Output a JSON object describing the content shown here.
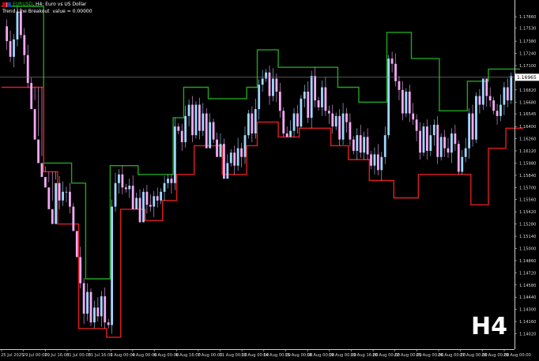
{
  "header": {
    "symbol": "EURUSD",
    "period_line": "H4:  Euro vs US Dollar",
    "indicator_name": "Trend Line Breakout",
    "indicator_value": "value = 0.00000"
  },
  "timeframe_badge": "H4",
  "current_price_label": "1.16965",
  "colors": {
    "background": "#000000",
    "upper_band": "#1fa51f",
    "lower_band": "#e01e1e",
    "bull_candle": "#9fd8ff",
    "bear_candle": "#f5a8f5",
    "axis_text": "#d8d8d8"
  },
  "chart_data": {
    "type": "candlestick",
    "title": "",
    "xlabel": "",
    "ylabel": "",
    "ylim": [
      1.1397,
      1.1778
    ],
    "grid": false,
    "y_ticks": [
      "1.17660",
      "1.17530",
      "1.17380",
      "1.17240",
      "1.17100",
      "1.16960",
      "1.16820",
      "1.16680",
      "1.16545",
      "1.16400",
      "1.16260",
      "1.16120",
      "1.15980",
      "1.15840",
      "1.15700",
      "1.15560",
      "1.15420",
      "1.15280",
      "1.15140",
      "1.15000",
      "1.14860",
      "1.14720",
      "1.14580",
      "1.14440",
      "1.14300",
      "1.14160",
      "1.14020"
    ],
    "x_ticks": [
      "25 Jul 2025",
      "29 Jul 00:00",
      "29 Jul 16:00",
      "31 Jul 00:00",
      "31 Jul 16:00",
      "1 Aug 00:00",
      "4 Aug 00:00",
      "6 Aug 00:00",
      "6 Aug 16:00",
      "7 Aug 00:00",
      "11 Aug 00:00",
      "13 Aug 00:00",
      "14 Aug 00:00",
      "15 Aug 00:00",
      "18 Aug 00:00",
      "19 Aug 00:00",
      "19 Aug 16:00",
      "20 Aug 00:00",
      "22 Aug 00:00",
      "25 Aug 00:00",
      "26 Aug 00:00",
      "27 Aug 00:00",
      "28 Aug 00:00",
      "29 Aug 00:00"
    ],
    "current_price": 1.16965,
    "closes": [
      1.1755,
      1.1738,
      1.172,
      1.174,
      1.1772,
      1.1745,
      1.1722,
      1.169,
      1.166,
      1.1625,
      1.1598,
      1.1582,
      1.157,
      1.1545,
      1.1528,
      1.1575,
      1.1555,
      1.1565,
      1.1565,
      1.1548,
      1.152,
      1.149,
      1.146,
      1.1425,
      1.145,
      1.1415,
      1.1432,
      1.1422,
      1.1445,
      1.1415,
      1.1412,
      1.1548,
      1.1575,
      1.1585,
      1.157,
      1.1568,
      1.1572,
      1.1545,
      1.1558,
      1.153,
      1.1565,
      1.155,
      1.1548,
      1.156,
      1.1555,
      1.1565,
      1.1575,
      1.158,
      1.1575,
      1.164,
      1.1635,
      1.1622,
      1.1652,
      1.1665,
      1.163,
      1.1665,
      1.1635,
      1.1655,
      1.1615,
      1.1645,
      1.1625,
      1.1605,
      1.162,
      1.158,
      1.1598,
      1.161,
      1.1595,
      1.1615,
      1.1605,
      1.163,
      1.1655,
      1.1632,
      1.166,
      1.1688,
      1.1695,
      1.1702,
      1.1675,
      1.1695,
      1.168,
      1.1658,
      1.1632,
      1.1628,
      1.1635,
      1.1655,
      1.164,
      1.1672,
      1.168,
      1.165,
      1.1698,
      1.167,
      1.1662,
      1.1685,
      1.1658,
      1.1655,
      1.164,
      1.1652,
      1.1625,
      1.1655,
      1.1645,
      1.1625,
      1.1612,
      1.163,
      1.161,
      1.1628,
      1.1608,
      1.1595,
      1.1608,
      1.159,
      1.1605,
      1.163,
      1.1718,
      1.1712,
      1.1692,
      1.1682,
      1.1655,
      1.168,
      1.1655,
      1.1648,
      1.1635,
      1.161,
      1.164,
      1.1612,
      1.163,
      1.1642,
      1.1605,
      1.1628,
      1.1615,
      1.161,
      1.1632,
      1.162,
      1.1588,
      1.1605,
      1.1615,
      1.1655,
      1.1625,
      1.1675,
      1.1665,
      1.1695,
      1.1675,
      1.167,
      1.1658,
      1.1652,
      1.1665,
      1.1685,
      1.167,
      1.1698
    ],
    "series": [
      {
        "name": "",
        "values": [
          1.1778,
          1.1778,
          1.1778,
          1.1778,
          1.1778,
          1.1778,
          1.1778,
          1.1778,
          1.1778,
          1.1778,
          1.1778,
          1.1778,
          1.1598,
          1.1598,
          1.1598,
          1.1598,
          1.1598,
          1.1598,
          1.1598,
          1.1598,
          1.1575,
          1.1575,
          1.1575,
          1.1575,
          1.1465,
          1.1465,
          1.1465,
          1.1465,
          1.1465,
          1.1465,
          1.1465,
          1.1595,
          1.1595,
          1.1595,
          1.1595,
          1.1595,
          1.1595,
          1.1595,
          1.1595,
          1.1585,
          1.1585,
          1.1585,
          1.1585,
          1.1585,
          1.1585,
          1.1585,
          1.1585,
          1.1585,
          1.1585,
          1.165,
          1.165,
          1.165,
          1.1685,
          1.1685,
          1.1685,
          1.1685,
          1.1685,
          1.1685,
          1.1685,
          1.1672,
          1.1672,
          1.1672,
          1.1672,
          1.1672,
          1.1672,
          1.1672,
          1.1672,
          1.1672,
          1.1672,
          1.1672,
          1.1685,
          1.1685,
          1.1685,
          1.1728,
          1.1728,
          1.1728,
          1.1728,
          1.1728,
          1.1728,
          1.1708,
          1.1708,
          1.1708,
          1.1708,
          1.1708,
          1.1708,
          1.1708,
          1.1708,
          1.1708,
          1.1708,
          1.1708,
          1.1708,
          1.1708,
          1.1708,
          1.1708,
          1.1708,
          1.1708,
          1.1685,
          1.1685,
          1.1685,
          1.1685,
          1.1685,
          1.1685,
          1.1668,
          1.1668,
          1.1668,
          1.1668,
          1.1668,
          1.1668,
          1.1668,
          1.1668,
          1.1748,
          1.1748,
          1.1748,
          1.1748,
          1.1748,
          1.1748,
          1.1748,
          1.1718,
          1.1718,
          1.1718,
          1.1718,
          1.1718,
          1.1718,
          1.1718,
          1.1718,
          1.1658,
          1.1658,
          1.1658,
          1.1658,
          1.1658,
          1.1658,
          1.1658,
          1.1658,
          1.1692,
          1.1692,
          1.1692,
          1.1692,
          1.1692,
          1.1692,
          1.1706,
          1.1706,
          1.1706,
          1.1706,
          1.1706,
          1.1706,
          1.1706,
          1.1706,
          1.1706
        ]
      },
      {
        "name": "",
        "values": [
          1.1685,
          1.1685,
          1.1685,
          1.1685,
          1.1685,
          1.1685,
          1.1685,
          1.1685,
          1.1685,
          1.1685,
          1.1685,
          1.1685,
          1.1588,
          1.1588,
          1.1588,
          1.1588,
          1.1528,
          1.1528,
          1.1528,
          1.1528,
          1.1528,
          1.1528,
          1.1408,
          1.1408,
          1.1408,
          1.1408,
          1.1408,
          1.1408,
          1.1408,
          1.1408,
          1.1398,
          1.1398,
          1.1398,
          1.1398,
          1.1545,
          1.1545,
          1.1545,
          1.1545,
          1.1545,
          1.1545,
          1.1545,
          1.1532,
          1.1532,
          1.1532,
          1.1532,
          1.1532,
          1.1555,
          1.1555,
          1.1555,
          1.1555,
          1.1585,
          1.1585,
          1.1585,
          1.1585,
          1.1585,
          1.1618,
          1.1618,
          1.1618,
          1.1618,
          1.1618,
          1.1618,
          1.1618,
          1.1618,
          1.1585,
          1.1585,
          1.1585,
          1.1585,
          1.1585,
          1.1585,
          1.1585,
          1.1618,
          1.1618,
          1.1618,
          1.1645,
          1.1645,
          1.1645,
          1.1645,
          1.1645,
          1.1645,
          1.1628,
          1.1628,
          1.1628,
          1.1628,
          1.1628,
          1.1628,
          1.1638,
          1.1638,
          1.1638,
          1.1638,
          1.1638,
          1.1638,
          1.1638,
          1.1638,
          1.1638,
          1.1618,
          1.1618,
          1.1618,
          1.1618,
          1.1618,
          1.1602,
          1.1602,
          1.1602,
          1.1602,
          1.1602,
          1.1602,
          1.1578,
          1.1578,
          1.1578,
          1.1578,
          1.1578,
          1.1578,
          1.1578,
          1.1558,
          1.1558,
          1.1558,
          1.1558,
          1.1558,
          1.1558,
          1.1558,
          1.1585,
          1.1585,
          1.1585,
          1.1585,
          1.1585,
          1.1585,
          1.1585,
          1.1585,
          1.1585,
          1.1585,
          1.1585,
          1.1585,
          1.1585,
          1.1585,
          1.1585,
          1.155,
          1.155,
          1.155,
          1.155,
          1.155,
          1.1615,
          1.1615,
          1.1615,
          1.1615,
          1.1615,
          1.1638,
          1.1638,
          1.1638,
          1.1638,
          1.1638
        ]
      }
    ]
  }
}
